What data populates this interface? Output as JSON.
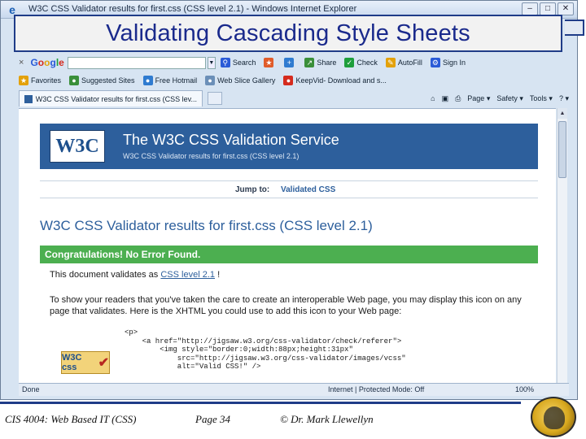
{
  "browser": {
    "window_title": "W3C CSS Validator results for first.css (CSS level 2.1) - Windows Internet Explorer",
    "window_buttons": [
      "–",
      "□",
      "✕"
    ]
  },
  "slide": {
    "title": "Validating Cascading Style Sheets",
    "footer_course": "CIS 4004: Web Based IT (CSS)",
    "footer_page": "Page 34",
    "footer_copyright": "© Dr. Mark Llewellyn"
  },
  "google_toolbar": {
    "close": "×",
    "logo": [
      "G",
      "o",
      "o",
      "g",
      "l",
      "e"
    ],
    "search_label": "Search",
    "share_label": "Share",
    "check_label": "Check",
    "autofill_label": "AutoFill",
    "signin_label": "Sign In"
  },
  "favorites_bar": {
    "favorites_label": "Favorites",
    "items": [
      "Suggested Sites",
      "Free Hotmail",
      "Web Slice Gallery",
      "KeepVid- Download and s..."
    ]
  },
  "tab_bar": {
    "tab_title": "W3C CSS Validator results for first.css (CSS lev...",
    "commands": [
      "Page",
      "Safety",
      "Tools",
      "?"
    ]
  },
  "page": {
    "logo_text": "W3C",
    "banner_heading": "The W3C CSS Validation Service",
    "banner_subtitle": "W3C CSS Validator results for first.css (CSS level 2.1)",
    "jump_label": "Jump to:",
    "jump_link": "Validated CSS",
    "results_heading": "W3C CSS Validator results for first.css (CSS level 2.1)",
    "congrats_text": "Congratulations! No Error Found.",
    "validates_prefix": "This document validates as ",
    "validates_link": "CSS level 2.1",
    "validates_suffix": " !",
    "icon_paragraph": "To show your readers that you've taken the care to create an interoperable Web page, you may display this icon on any page that validates. Here is the XHTML you could use to add this icon to your Web page:",
    "code_snippet": "<p>\n    <a href=\"http://jigsaw.w3.org/css-validator/check/referer\">\n        <img style=\"border:0;width:88px;height:31px\"\n            src=\"http://jigsaw.w3.org/css-validator/images/vcss\"\n            alt=\"Valid CSS!\" />",
    "badge_text": "W3C css",
    "badge_tick": "✔"
  },
  "status_bar": {
    "done": "Done",
    "zone": "Internet | Protected Mode: Off",
    "zoom": "100%"
  }
}
